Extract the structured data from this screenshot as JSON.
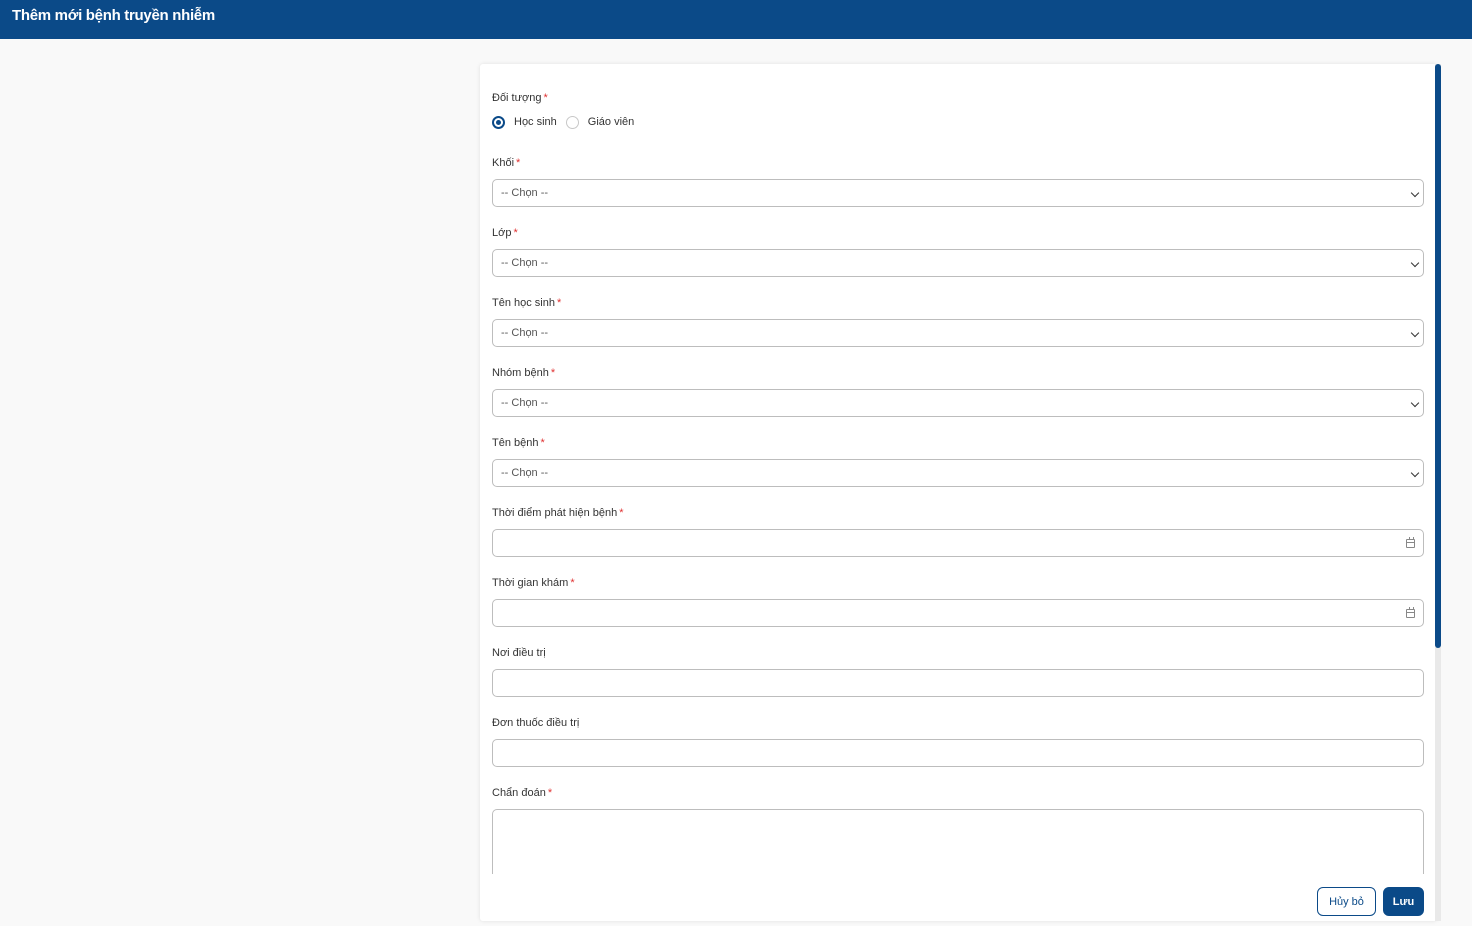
{
  "header": {
    "title": "Thêm mới bệnh truyền nhiễm"
  },
  "form": {
    "doi_tuong": {
      "label": "Đối tượng",
      "required": "*",
      "options": [
        {
          "label": "Học sinh",
          "checked": true
        },
        {
          "label": "Giáo viên",
          "checked": false
        }
      ]
    },
    "khoi": {
      "label": "Khối",
      "required": "*",
      "value": "-- Chọn --"
    },
    "lop": {
      "label": "Lớp",
      "required": "*",
      "value": "-- Chọn --"
    },
    "ten_hoc_sinh": {
      "label": "Tên học sinh",
      "required": "*",
      "value": "-- Chọn --"
    },
    "nhom_benh": {
      "label": "Nhóm bệnh",
      "required": "*",
      "value": "-- Chọn --"
    },
    "ten_benh": {
      "label": "Tên bệnh",
      "required": "*",
      "value": "-- Chọn --"
    },
    "thoi_diem_phat_hien": {
      "label": "Thời điểm phát hiện bệnh",
      "required": "*",
      "value": ""
    },
    "thoi_gian_kham": {
      "label": "Thời gian khám",
      "required": "*",
      "value": ""
    },
    "noi_dieu_tri": {
      "label": "Nơi điều trị",
      "value": ""
    },
    "don_thuoc": {
      "label": "Đơn thuốc điều trị",
      "value": ""
    },
    "chan_doan": {
      "label": "Chẩn đoán",
      "required": "*",
      "value": ""
    }
  },
  "actions": {
    "cancel_label": "Hủy bỏ",
    "save_label": "Lưu"
  },
  "colors": {
    "primary": "#0b4a88",
    "required": "#e03131",
    "border": "#bdbdbd"
  },
  "icons": {
    "select": "chevron-down-icon",
    "date": "calendar-icon"
  }
}
